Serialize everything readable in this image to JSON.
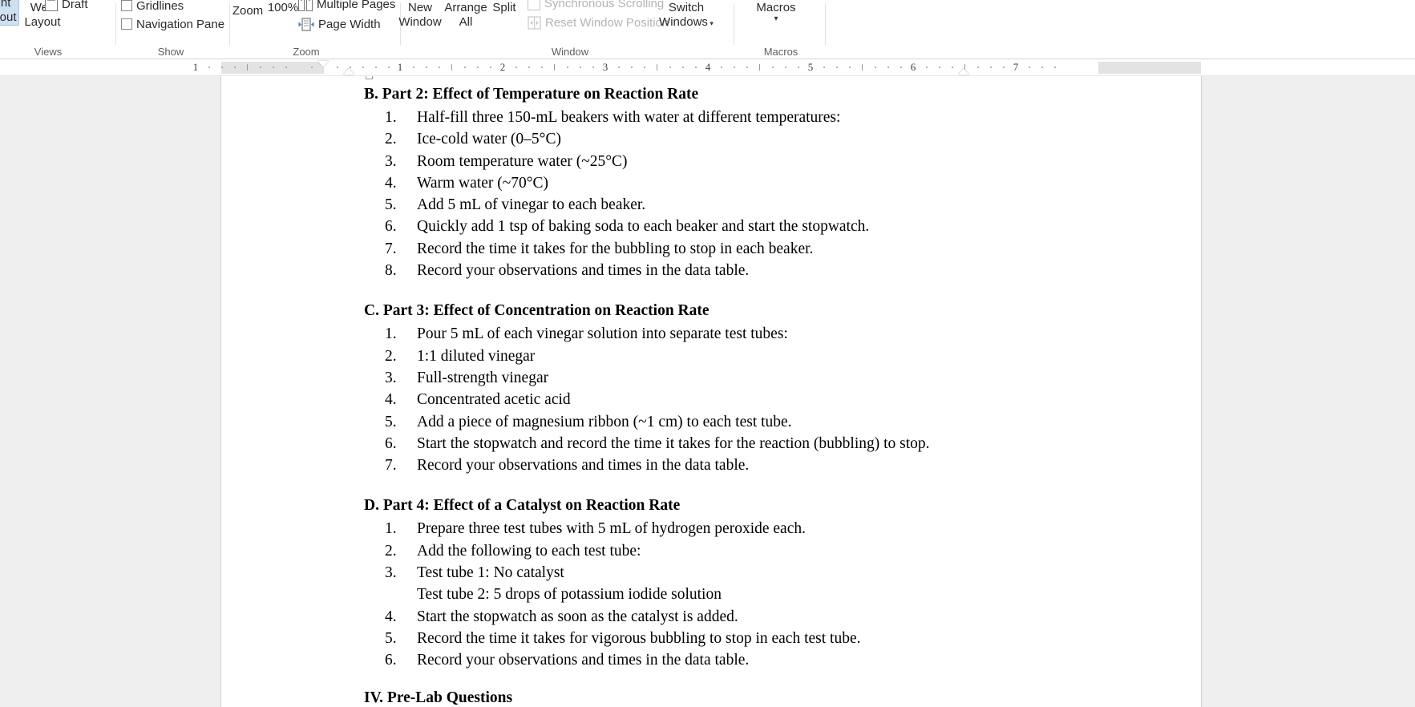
{
  "app": "Microsoft Word",
  "ribbon": {
    "groups": [
      {
        "name": "views",
        "label": "Views"
      },
      {
        "name": "show",
        "label": "Show"
      },
      {
        "name": "zoom",
        "label": "Zoom"
      },
      {
        "name": "window",
        "label": "Window"
      },
      {
        "name": "macros",
        "label": "Macros"
      }
    ],
    "views": {
      "print_layout": {
        "line1": "Print",
        "line2": "Layout",
        "icon": "print-layout-icon",
        "selected": true
      },
      "web_layout": {
        "line1": "Web",
        "line2": "Layout",
        "icon": "web-layout-icon"
      },
      "draft": {
        "label": "Draft",
        "icon": "draft-icon"
      }
    },
    "show": {
      "gridlines": {
        "label": "Gridlines",
        "checked": false
      },
      "navigation_pane": {
        "label": "Navigation Pane",
        "checked": false
      }
    },
    "zoom": {
      "zoom_button": {
        "label": "Zoom",
        "icon": "zoom-icon"
      },
      "zoom_100": {
        "label": "100%",
        "icon": "zoom-100-icon"
      },
      "multiple_pages": {
        "label": "Multiple Pages",
        "icon": "multiple-pages-icon"
      },
      "page_width": {
        "label": "Page Width",
        "icon": "page-width-icon"
      }
    },
    "window": {
      "new_window": {
        "line1": "New",
        "line2": "Window",
        "icon": "new-window-icon"
      },
      "arrange_all": {
        "line1": "Arrange",
        "line2": "All",
        "icon": "arrange-all-icon"
      },
      "split": {
        "label": "Split",
        "icon": "split-icon"
      },
      "synchronous_scrolling": {
        "label": "Synchronous Scrolling",
        "icon": "synchronous-scrolling-icon",
        "disabled": true
      },
      "reset_window_position": {
        "label": "Reset Window Position",
        "icon": "reset-window-position-icon",
        "disabled": true
      },
      "switch_windows": {
        "line1": "Switch",
        "line2": "Windows",
        "icon": "switch-windows-icon",
        "has_dropdown": true
      }
    },
    "macros": {
      "macros_button": {
        "label": "Macros",
        "icon": "macros-icon",
        "has_dropdown": true
      }
    }
  },
  "ruler": {
    "numbers": [
      "1",
      "1",
      "2",
      "3",
      "4",
      "5",
      "6",
      "7"
    ],
    "unit": "inch"
  },
  "document": {
    "sections": [
      {
        "heading": "B. Part 2: Effect of Temperature on Reaction Rate",
        "items": [
          {
            "num": "1.",
            "text": "Half-fill three 150-mL beakers with water at different temperatures:"
          },
          {
            "num": "2.",
            "text": "Ice-cold water (0–5°C)"
          },
          {
            "num": "3.",
            "text": "Room temperature water (~25°C)"
          },
          {
            "num": "4.",
            "text": "Warm water (~70°C)"
          },
          {
            "num": "5.",
            "text": "Add 5 mL of vinegar to each beaker."
          },
          {
            "num": "6.",
            "text": "Quickly add 1 tsp of baking soda to each beaker and start the stopwatch."
          },
          {
            "num": "7.",
            "text": "Record the time it takes for the bubbling to stop in each beaker."
          },
          {
            "num": "8.",
            "text": "Record your observations and times in the data table."
          }
        ]
      },
      {
        "heading": "C. Part 3: Effect of Concentration on Reaction Rate",
        "items": [
          {
            "num": "1.",
            "text": "Pour 5 mL of each vinegar solution into separate test tubes:"
          },
          {
            "num": "2.",
            "text": "1:1 diluted vinegar"
          },
          {
            "num": "3.",
            "text": "Full-strength vinegar"
          },
          {
            "num": "4.",
            "text": "Concentrated acetic acid"
          },
          {
            "num": "5.",
            "text": "Add a piece of magnesium ribbon (~1 cm) to each test tube."
          },
          {
            "num": "6.",
            "text": "Start the stopwatch and record the time it takes for the reaction (bubbling) to stop."
          },
          {
            "num": "7.",
            "text": "Record your observations and times in the data table."
          }
        ]
      },
      {
        "heading": "D. Part 4: Effect of a Catalyst on Reaction Rate",
        "items": [
          {
            "num": "1.",
            "text": "Prepare three test tubes with 5 mL of hydrogen peroxide each."
          },
          {
            "num": "2.",
            "text": "Add the following to each test tube:"
          },
          {
            "num": "3.",
            "text": "Test tube 1: No catalyst"
          },
          {
            "num": "",
            "text": "Test tube 2: 5 drops of potassium iodide solution"
          },
          {
            "num": "4.",
            "text": "Start the stopwatch as soon as the catalyst is added."
          },
          {
            "num": "5.",
            "text": "Record the time it takes for vigorous bubbling to stop in each test tube."
          },
          {
            "num": "6.",
            "text": "Record your observations and times in the data table."
          }
        ]
      }
    ],
    "next_heading_partial": "IV. Pre-Lab Questions"
  }
}
